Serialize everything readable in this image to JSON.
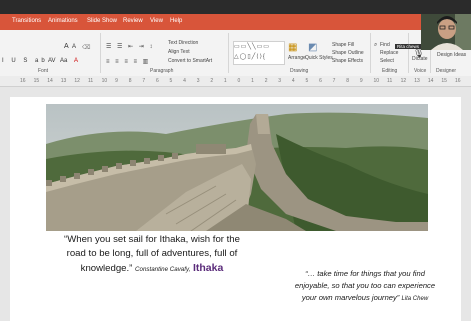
{
  "ribbon_tabs": [
    "Transitions",
    "Animations",
    "Slide Show",
    "Review",
    "View",
    "Help"
  ],
  "ribbon_groups": {
    "font": "Font",
    "paragraph": "Paragraph",
    "drawing": "Drawing",
    "editing": "Editing",
    "voice": "Voice",
    "designer": "Designer"
  },
  "ribbon_buttons": {
    "text_direction": "Text Direction",
    "align_text": "Align Text",
    "convert_smartart": "Convert to SmartArt",
    "arrange": "Arrange",
    "quick_styles": "Quick Styles",
    "shape_fill": "Shape Fill",
    "shape_outline": "Shape Outline",
    "shape_effects": "Shape Effects",
    "find": "Find",
    "replace": "Replace",
    "select": "Select",
    "dictate": "Dictate",
    "design_ideas": "Design Ideas"
  },
  "ruler_ticks": [
    "16",
    "15",
    "14",
    "13",
    "12",
    "11",
    "10",
    "9",
    "8",
    "7",
    "6",
    "5",
    "4",
    "3",
    "2",
    "1",
    "0",
    "1",
    "2",
    "3",
    "4",
    "5",
    "6",
    "7",
    "8",
    "9",
    "10",
    "11",
    "12",
    "13",
    "14",
    "15",
    "16"
  ],
  "webcam": {
    "label": "Rita chews"
  },
  "slide": {
    "quote1_line1": "“When you set sail for Ithaka, wish for the",
    "quote1_line2": "road to be long, full of adventures, full of",
    "quote1_line3": "knowledge.”",
    "quote1_author": "Constantine Cavafy,",
    "quote1_title": "Ithaka",
    "quote2_line1": "“… take time for things that you find",
    "quote2_line2": "enjoyable, so that you too can experience",
    "quote2_line3": "your own marvelous journey”",
    "quote2_author": "Lita Chew"
  },
  "colors": {
    "ribbon_accent": "#d8553a",
    "ithaka_purple": "#5a2b7a"
  }
}
